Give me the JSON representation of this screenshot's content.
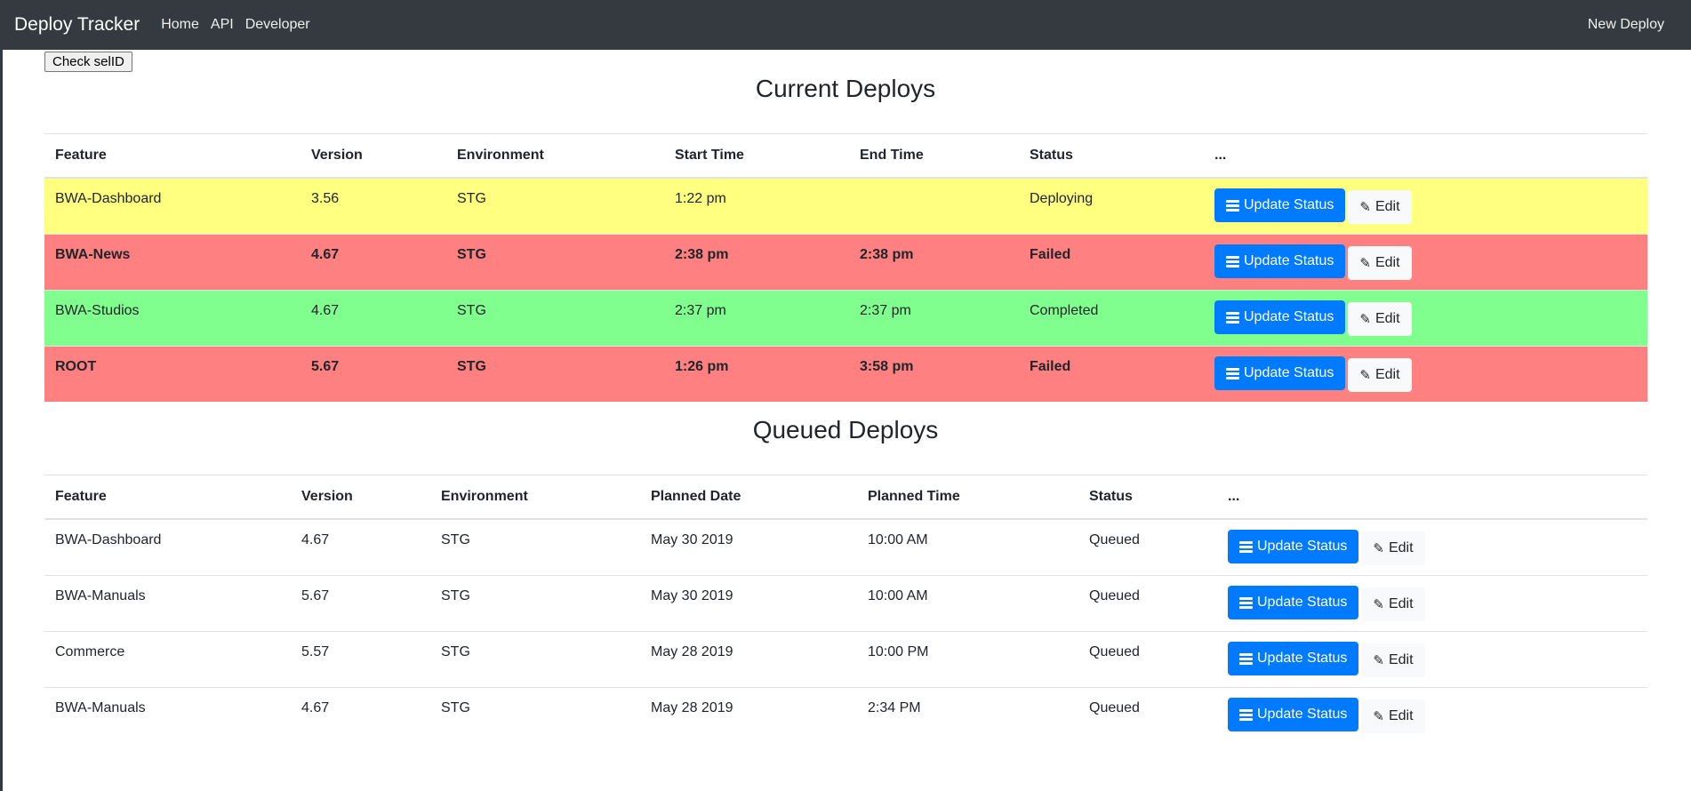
{
  "navbar": {
    "brand": "Deploy Tracker",
    "links": [
      "Home",
      "API",
      "Developer"
    ],
    "new_deploy": "New Deploy"
  },
  "check_button": "Check selID",
  "actions": {
    "update_label": "Update Status",
    "edit_label": "Edit"
  },
  "colors": {
    "navbar": "#343a40",
    "primary": "#007bff",
    "deploying": "#ffff80",
    "failed": "#ff8080",
    "completed": "#80ff8f"
  },
  "current": {
    "title": "Current Deploys",
    "headers": [
      "Feature",
      "Version",
      "Environment",
      "Start Time",
      "End Time",
      "Status",
      "..."
    ],
    "rows": [
      {
        "feature": "BWA-Dashboard",
        "version": "3.56",
        "environment": "STG",
        "start": "1:22 pm",
        "end": "",
        "status": "Deploying"
      },
      {
        "feature": "BWA-News",
        "version": "4.67",
        "environment": "STG",
        "start": "2:38 pm",
        "end": "2:38 pm",
        "status": "Failed"
      },
      {
        "feature": "BWA-Studios",
        "version": "4.67",
        "environment": "STG",
        "start": "2:37 pm",
        "end": "2:37 pm",
        "status": "Completed"
      },
      {
        "feature": "ROOT",
        "version": "5.67",
        "environment": "STG",
        "start": "1:26 pm",
        "end": "3:58 pm",
        "status": "Failed"
      }
    ]
  },
  "queued": {
    "title": "Queued Deploys",
    "headers": [
      "Feature",
      "Version",
      "Environment",
      "Planned Date",
      "Planned Time",
      "Status",
      "..."
    ],
    "rows": [
      {
        "feature": "BWA-Dashboard",
        "version": "4.67",
        "environment": "STG",
        "date": "May 30 2019",
        "time": "10:00 AM",
        "status": "Queued"
      },
      {
        "feature": "BWA-Manuals",
        "version": "5.67",
        "environment": "STG",
        "date": "May 30 2019",
        "time": "10:00 AM",
        "status": "Queued"
      },
      {
        "feature": "Commerce",
        "version": "5.57",
        "environment": "STG",
        "date": "May 28 2019",
        "time": "10:00 PM",
        "status": "Queued"
      },
      {
        "feature": "BWA-Manuals",
        "version": "4.67",
        "environment": "STG",
        "date": "May 28 2019",
        "time": "2:34 PM",
        "status": "Queued"
      }
    ]
  }
}
